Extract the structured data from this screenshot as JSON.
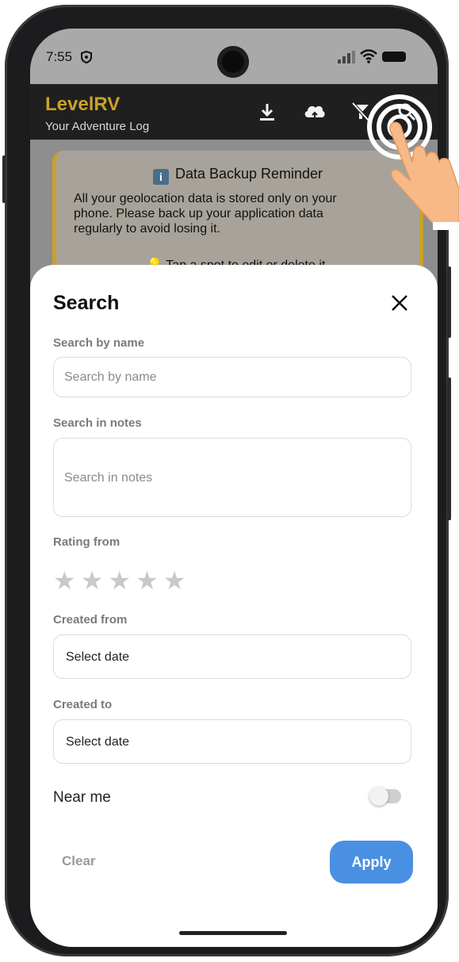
{
  "status_bar": {
    "time": "7:55"
  },
  "app_bar": {
    "title": "LevelRV",
    "subtitle": "Your Adventure Log",
    "title_color": "#c9a227",
    "icons": [
      "download-icon",
      "cloud-upload-icon",
      "filter-off-icon",
      "search-icon"
    ]
  },
  "reminder": {
    "icon": "ℹ️",
    "title": "Data Backup Reminder",
    "body": "All your geolocation data is stored only on your phone. Please back up your application data regularly to avoid losing it.",
    "tip_icon": "💡",
    "tip": "Tap a spot to edit or delete it."
  },
  "search_sheet": {
    "title": "Search",
    "name_label": "Search by name",
    "name_placeholder": "Search by name",
    "notes_label": "Search in notes",
    "notes_placeholder": "Search in notes",
    "rating_label": "Rating from",
    "rating_stars": [
      "★",
      "★",
      "★",
      "★",
      "★"
    ],
    "created_from_label": "Created from",
    "created_from_value": "Select date",
    "created_to_label": "Created to",
    "created_to_value": "Select date",
    "near_me_label": "Near me",
    "near_me_enabled": false,
    "clear_label": "Clear",
    "apply_label": "Apply",
    "apply_color": "#4a90e2"
  }
}
